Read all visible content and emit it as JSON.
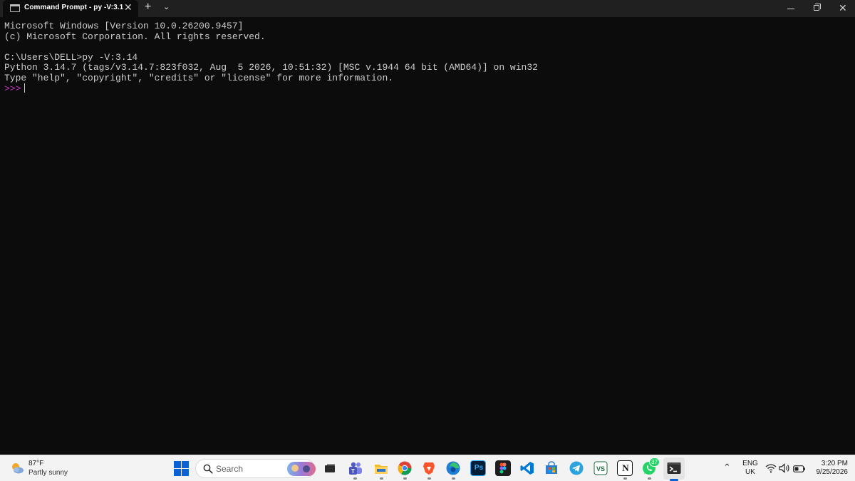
{
  "window": {
    "tab_title": "Command Prompt - py  -V:3.1",
    "tab_close": "✕",
    "new_tab": "+",
    "tab_menu": "⌄"
  },
  "console": {
    "lines": [
      "Microsoft Windows [Version 10.0.26200.9457]",
      "(c) Microsoft Corporation. All rights reserved.",
      "",
      "C:\\Users\\DELL>py -V:3.14",
      "Python 3.14.7 (tags/v3.14.7:823f032, Aug  5 2026, 10:51:32) [MSC v.1944 64 bit (AMD64)] on win32",
      "Type \"help\", \"copyright\", \"credits\" or \"license\" for more information."
    ],
    "prompt": ">>>",
    "text_color": "#cccccc",
    "prompt_color": "#c837c8",
    "background": "#0c0c0c"
  },
  "taskbar": {
    "weather": {
      "temp": "87°F",
      "condition": "Partly sunny",
      "icon": "partly-sunny-icon"
    },
    "search_placeholder": "Search",
    "apps": [
      {
        "name": "task-view",
        "icon": "task-view-icon"
      },
      {
        "name": "teams",
        "icon": "teams-icon"
      },
      {
        "name": "file-explorer",
        "icon": "folder-icon"
      },
      {
        "name": "chrome",
        "icon": "chrome-icon"
      },
      {
        "name": "brave",
        "icon": "brave-icon"
      },
      {
        "name": "edge",
        "icon": "edge-icon"
      },
      {
        "name": "photoshop",
        "icon": "photoshop-icon",
        "label": "Ps"
      },
      {
        "name": "figma",
        "icon": "figma-icon"
      },
      {
        "name": "vscode",
        "icon": "vscode-icon"
      },
      {
        "name": "microsoft-store",
        "icon": "store-icon"
      },
      {
        "name": "telegram",
        "icon": "telegram-icon"
      },
      {
        "name": "vs-app",
        "icon": "vs-app-icon"
      },
      {
        "name": "notion",
        "icon": "notion-icon",
        "label": "N"
      },
      {
        "name": "whatsapp",
        "icon": "whatsapp-icon",
        "badge": "37"
      },
      {
        "name": "terminal",
        "icon": "terminal-icon"
      }
    ],
    "tray": {
      "chevron": "⌃",
      "language": "ENG",
      "region": "UK",
      "time": "3:20 PM",
      "date": "9/25/2026"
    }
  }
}
